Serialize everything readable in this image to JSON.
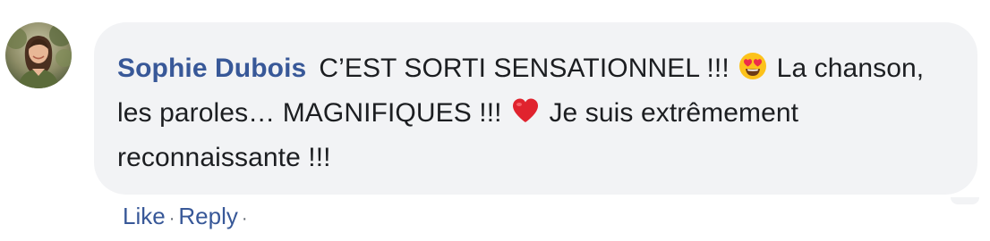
{
  "comment": {
    "author": "Sophie Dubois",
    "text_part1": "C’EST SORTI SENSATIONNEL !!!",
    "emoji1": "heart-eyes-emoji",
    "text_part2": "La chanson, les paroles… MAGNIFIQUES !!!",
    "emoji2": "red-heart-emoji",
    "text_part3": "Je suis extrêmement reconnaissante !!!"
  },
  "actions": {
    "like_label": "Like",
    "reply_label": "Reply",
    "separator": "·"
  },
  "colors": {
    "author_link": "#385898",
    "bubble_bg": "#f2f3f5",
    "text": "#1c1e21"
  }
}
